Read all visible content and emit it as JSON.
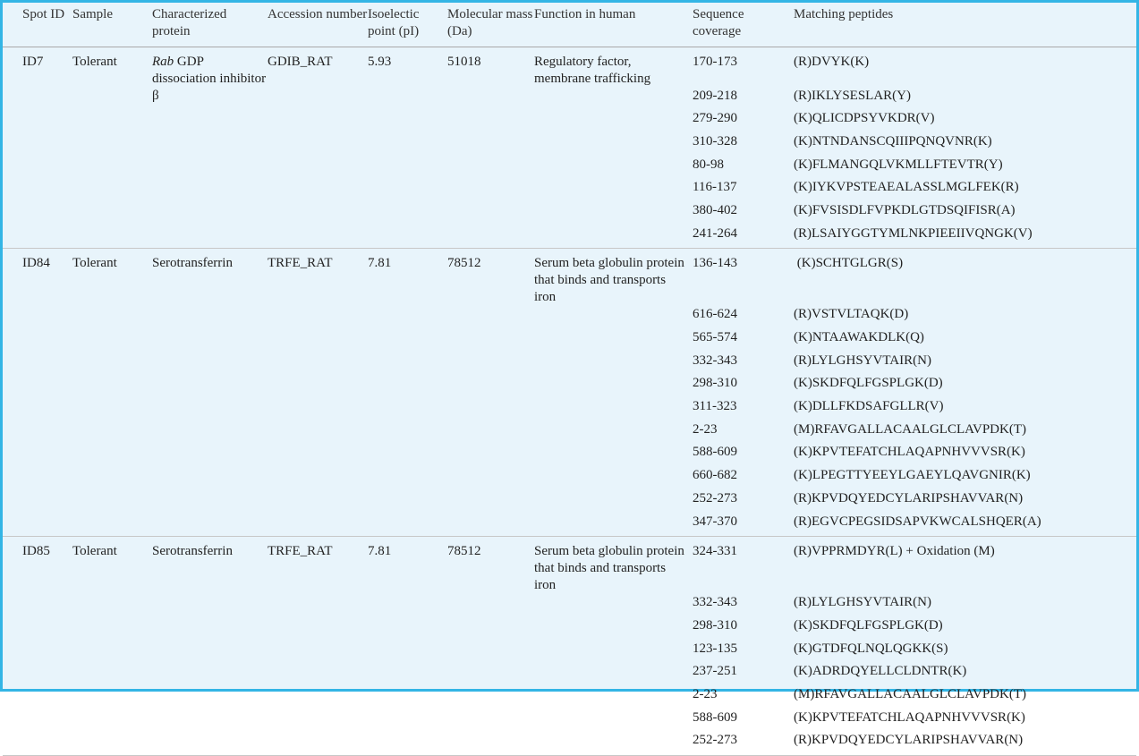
{
  "headers": [
    "Spot ID",
    "Sample",
    "Characterized protein",
    "Accession number",
    "Isoelectic point (pI)",
    "Molecular mass (Da)",
    "Function in human",
    "Sequence coverage",
    "Matching peptides"
  ],
  "groups": [
    {
      "spot_id": "ID7",
      "sample": "Tolerant",
      "protein_italic": "Rab",
      "protein_rest": " GDP dissociation inhibitor β",
      "accession": "GDIB_RAT",
      "pi": "5.93",
      "mass": "51018",
      "function": "Regulatory factor, membrane trafficking",
      "peptides": [
        {
          "coverage": "170-173",
          "sequence": "(R)DVYK(K)"
        },
        {
          "coverage": "209-218",
          "sequence": "(R)IKLYSESLAR(Y)"
        },
        {
          "coverage": "279-290",
          "sequence": "(K)QLICDPSYVKDR(V)"
        },
        {
          "coverage": "310-328",
          "sequence": "(K)NTNDANSCQIIIPQNQVNR(K)"
        },
        {
          "coverage": "80-98",
          "sequence": "(K)FLMANGQLVKMLLFTEVTR(Y)"
        },
        {
          "coverage": "116-137",
          "sequence": "(K)IYKVPSTEAEALASSLMGLFEK(R)"
        },
        {
          "coverage": "380-402",
          "sequence": "(K)FVSISDLFVPKDLGTDSQIFISR(A)"
        },
        {
          "coverage": "241-264",
          "sequence": "(R)LSAIYGGTYMLNKPIEEIIVQNGK(V)"
        }
      ]
    },
    {
      "spot_id": "ID84",
      "sample": "Tolerant",
      "protein_italic": "",
      "protein_rest": "Serotransferrin",
      "accession": "TRFE_RAT",
      "pi": "7.81",
      "mass": "78512",
      "function": "Serum beta globulin protein that binds and transports iron",
      "peptides": [
        {
          "coverage": "136-143",
          "sequence": " (K)SCHTGLGR(S)"
        },
        {
          "coverage": "616-624",
          "sequence": "(R)VSTVLTAQK(D)"
        },
        {
          "coverage": "565-574",
          "sequence": "(K)NTAAWAKDLK(Q)"
        },
        {
          "coverage": "332-343",
          "sequence": "(R)LYLGHSYVTAIR(N)"
        },
        {
          "coverage": "298-310",
          "sequence": "(K)SKDFQLFGSPLGK(D)"
        },
        {
          "coverage": "311-323",
          "sequence": "(K)DLLFKDSAFGLLR(V)"
        },
        {
          "coverage": "2-23",
          "sequence": "(M)RFAVGALLACAALGLCLAVPDK(T)"
        },
        {
          "coverage": "588-609",
          "sequence": "(K)KPVTEFATCHLAQAPNHVVVSR(K)"
        },
        {
          "coverage": "660-682",
          "sequence": "(K)LPEGTTYEEYLGAEYLQAVGNIR(K)"
        },
        {
          "coverage": "252-273",
          "sequence": "(R)KPVDQYEDCYLARIPSHAVVAR(N)"
        },
        {
          "coverage": "347-370",
          "sequence": "(R)EGVCPEGSIDSAPVKWCALSHQER(A)"
        }
      ]
    },
    {
      "spot_id": "ID85",
      "sample": "Tolerant",
      "protein_italic": "",
      "protein_rest": "Serotransferrin",
      "accession": "TRFE_RAT",
      "pi": "7.81",
      "mass": "78512",
      "function": "Serum beta globulin protein that binds and transports iron",
      "peptides": [
        {
          "coverage": "324-331",
          "sequence": "(R)VPPRMDYR(L) + Oxidation (M)"
        },
        {
          "coverage": "332-343",
          "sequence": "(R)LYLGHSYVTAIR(N)"
        },
        {
          "coverage": "298-310",
          "sequence": "(K)SKDFQLFGSPLGK(D)"
        },
        {
          "coverage": "123-135",
          "sequence": "(K)GTDFQLNQLQGKK(S)"
        },
        {
          "coverage": "237-251",
          "sequence": "(K)ADRDQYELLCLDNTR(K)"
        },
        {
          "coverage": "2-23",
          "sequence": "(M)RFAVGALLACAALGLCLAVPDK(T)"
        },
        {
          "coverage": "588-609",
          "sequence": "(K)KPVTEFATCHLAQAPNHVVVSR(K)"
        },
        {
          "coverage": "252-273",
          "sequence": "(R)KPVDQYEDCYLARIPSHAVVAR(N)"
        }
      ]
    }
  ]
}
